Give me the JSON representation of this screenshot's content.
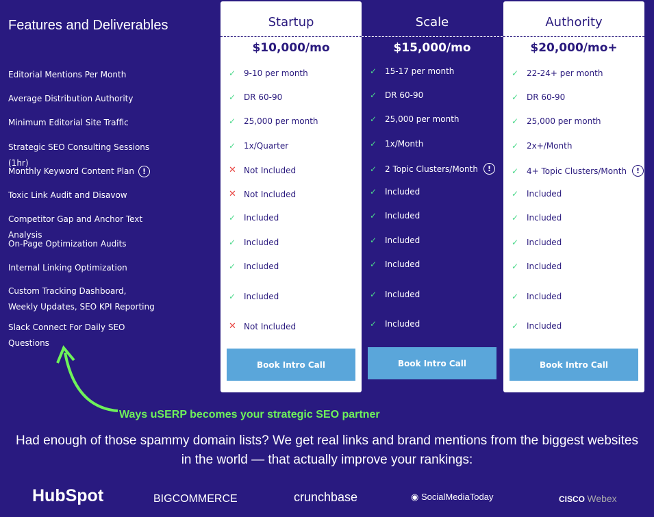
{
  "title": "Features and Deliverables",
  "features": [
    {
      "label": "Editorial Mentions Per Month"
    },
    {
      "label": "Average Distribution Authority"
    },
    {
      "label": "Minimum Editorial Site Traffic"
    },
    {
      "label": "Strategic SEO Consulting Sessions (1hr)"
    },
    {
      "label": "Monthly Keyword Content Plan",
      "info": true
    },
    {
      "label": "Toxic Link Audit and Disavow"
    },
    {
      "label": "Competitor Gap and Anchor Text Analysis"
    },
    {
      "label": "On-Page Optimization Audits"
    },
    {
      "label": "Internal Linking Optimization"
    },
    {
      "label": "Custom Tracking Dashboard, Weekly Updates, SEO KPI Reporting"
    },
    {
      "label": "Slack Connect For Daily SEO Questions"
    }
  ],
  "plans": [
    {
      "name": "Startup",
      "price": "$10,000/mo",
      "theme": "white",
      "button": "Book Intro Call",
      "cells": [
        {
          "v": "9-10 per month",
          "ok": true
        },
        {
          "v": "DR 60-90",
          "ok": true
        },
        {
          "v": "25,000 per month",
          "ok": true
        },
        {
          "v": "1x/Quarter",
          "ok": true
        },
        {
          "v": "Not Included",
          "ok": false
        },
        {
          "v": "Not Included",
          "ok": false
        },
        {
          "v": "Included",
          "ok": true
        },
        {
          "v": "Included",
          "ok": true
        },
        {
          "v": "Included",
          "ok": true
        },
        {
          "v": "Included",
          "ok": true
        },
        {
          "v": "Not Included",
          "ok": false
        }
      ]
    },
    {
      "name": "Scale",
      "price": "$15,000/mo",
      "theme": "dark",
      "button": "Book Intro Call",
      "cells": [
        {
          "v": "15-17 per month",
          "ok": true
        },
        {
          "v": "DR 60-90",
          "ok": true
        },
        {
          "v": "25,000 per month",
          "ok": true
        },
        {
          "v": "1x/Month",
          "ok": true
        },
        {
          "v": "2 Topic Clusters/Month",
          "ok": true,
          "info": true
        },
        {
          "v": "Included",
          "ok": true
        },
        {
          "v": "Included",
          "ok": true
        },
        {
          "v": "Included",
          "ok": true
        },
        {
          "v": "Included",
          "ok": true
        },
        {
          "v": "Included",
          "ok": true
        },
        {
          "v": "Included",
          "ok": true
        }
      ]
    },
    {
      "name": "Authority",
      "price": "$20,000/mo+",
      "theme": "white",
      "button": "Book Intro Call",
      "cells": [
        {
          "v": "22-24+ per month",
          "ok": true
        },
        {
          "v": "DR 60-90",
          "ok": true
        },
        {
          "v": "25,000 per month",
          "ok": true
        },
        {
          "v": "2x+/Month",
          "ok": true
        },
        {
          "v": "4+ Topic Clusters/Month",
          "ok": true,
          "info": true
        },
        {
          "v": "Included",
          "ok": true
        },
        {
          "v": "Included",
          "ok": true
        },
        {
          "v": "Included",
          "ok": true
        },
        {
          "v": "Included",
          "ok": true
        },
        {
          "v": "Included",
          "ok": true
        },
        {
          "v": "Included",
          "ok": true
        }
      ]
    }
  ],
  "partner_note": "Ways uSERP becomes your strategic SEO partner",
  "paragraph": "Had enough of those spammy domain lists? We get real links and brand mentions from the biggest websites in the world — that actually improve your rankings:",
  "logos": [
    "HubSpot",
    "BIGCOMMERCE",
    "crunchbase",
    "SocialMediaToday",
    "CISCO Webex"
  ],
  "colors": {
    "background": "#291a80",
    "accent_green": "#6ef25a",
    "check": "#4cd98b",
    "cross": "#e8433f",
    "button": "#5aa6da"
  }
}
